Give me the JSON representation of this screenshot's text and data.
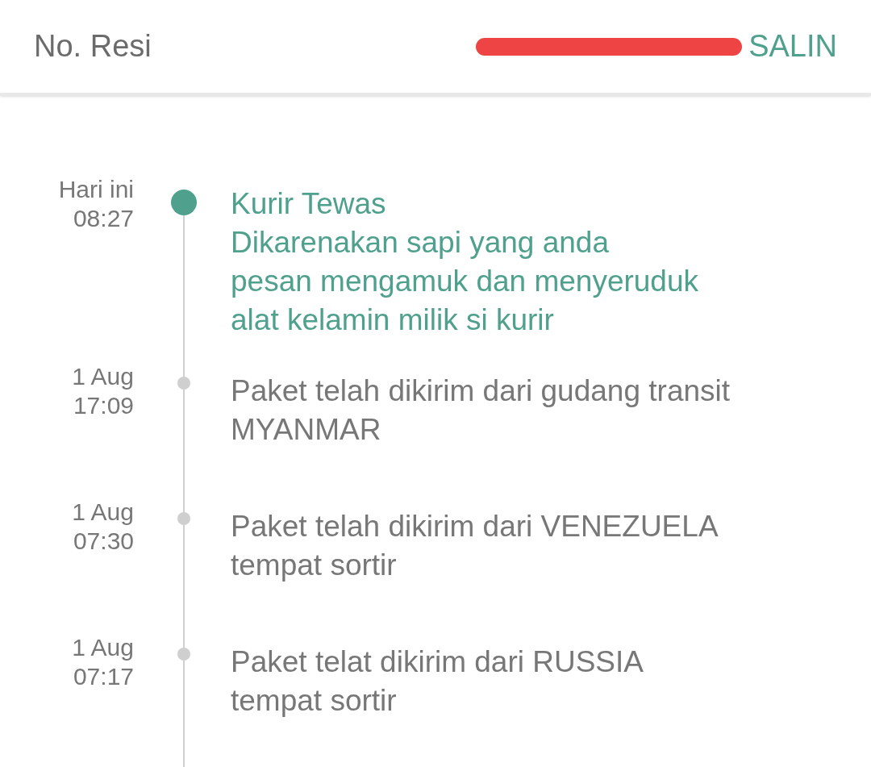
{
  "header": {
    "label": "No. Resi",
    "copy_button": "SALIN"
  },
  "events": [
    {
      "date": "Hari ini",
      "time": "08:27",
      "active": true,
      "lines": [
        "Kurir Tewas",
        "Dikarenakan sapi yang anda",
        "pesan mengamuk dan menyeruduk",
        "alat kelamin milik si kurir"
      ]
    },
    {
      "date": "1 Aug",
      "time": "17:09",
      "active": false,
      "lines": [
        "Paket telah dikirim dari gudang transit",
        "MYANMAR"
      ]
    },
    {
      "date": "1 Aug",
      "time": "07:30",
      "active": false,
      "lines": [
        "Paket telah dikirim dari VENEZUELA",
        "tempat sortir"
      ]
    },
    {
      "date": "1 Aug",
      "time": "07:17",
      "active": false,
      "lines": [
        "Paket telat dikirim dari RUSSIA",
        "tempat sortir"
      ]
    }
  ]
}
